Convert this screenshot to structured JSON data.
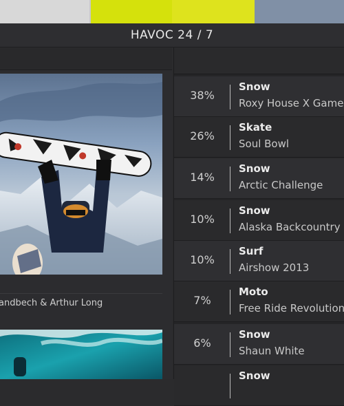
{
  "header": {
    "title": "HAVOC 24 / 7"
  },
  "strip_colors": [
    "#d7d7d7",
    "#c9c9c9",
    "#d4e00a",
    "#dfe31b",
    "#7f8fa5"
  ],
  "feature": {
    "caption": "andbech & Arthur Long"
  },
  "rankings": [
    {
      "percent": "38%",
      "category": "Snow",
      "name": "Roxy House X Games"
    },
    {
      "percent": "26%",
      "category": "Skate",
      "name": "Soul Bowl"
    },
    {
      "percent": "14%",
      "category": "Snow",
      "name": "Arctic Challenge"
    },
    {
      "percent": "10%",
      "category": "Snow",
      "name": "Alaska Backcountry"
    },
    {
      "percent": "10%",
      "category": "Surf",
      "name": "Airshow 2013"
    },
    {
      "percent": "7%",
      "category": "Moto",
      "name": "Free Ride Revolution"
    },
    {
      "percent": "6%",
      "category": "Snow",
      "name": "Shaun White"
    },
    {
      "percent": "",
      "category": "Snow",
      "name": ""
    }
  ]
}
